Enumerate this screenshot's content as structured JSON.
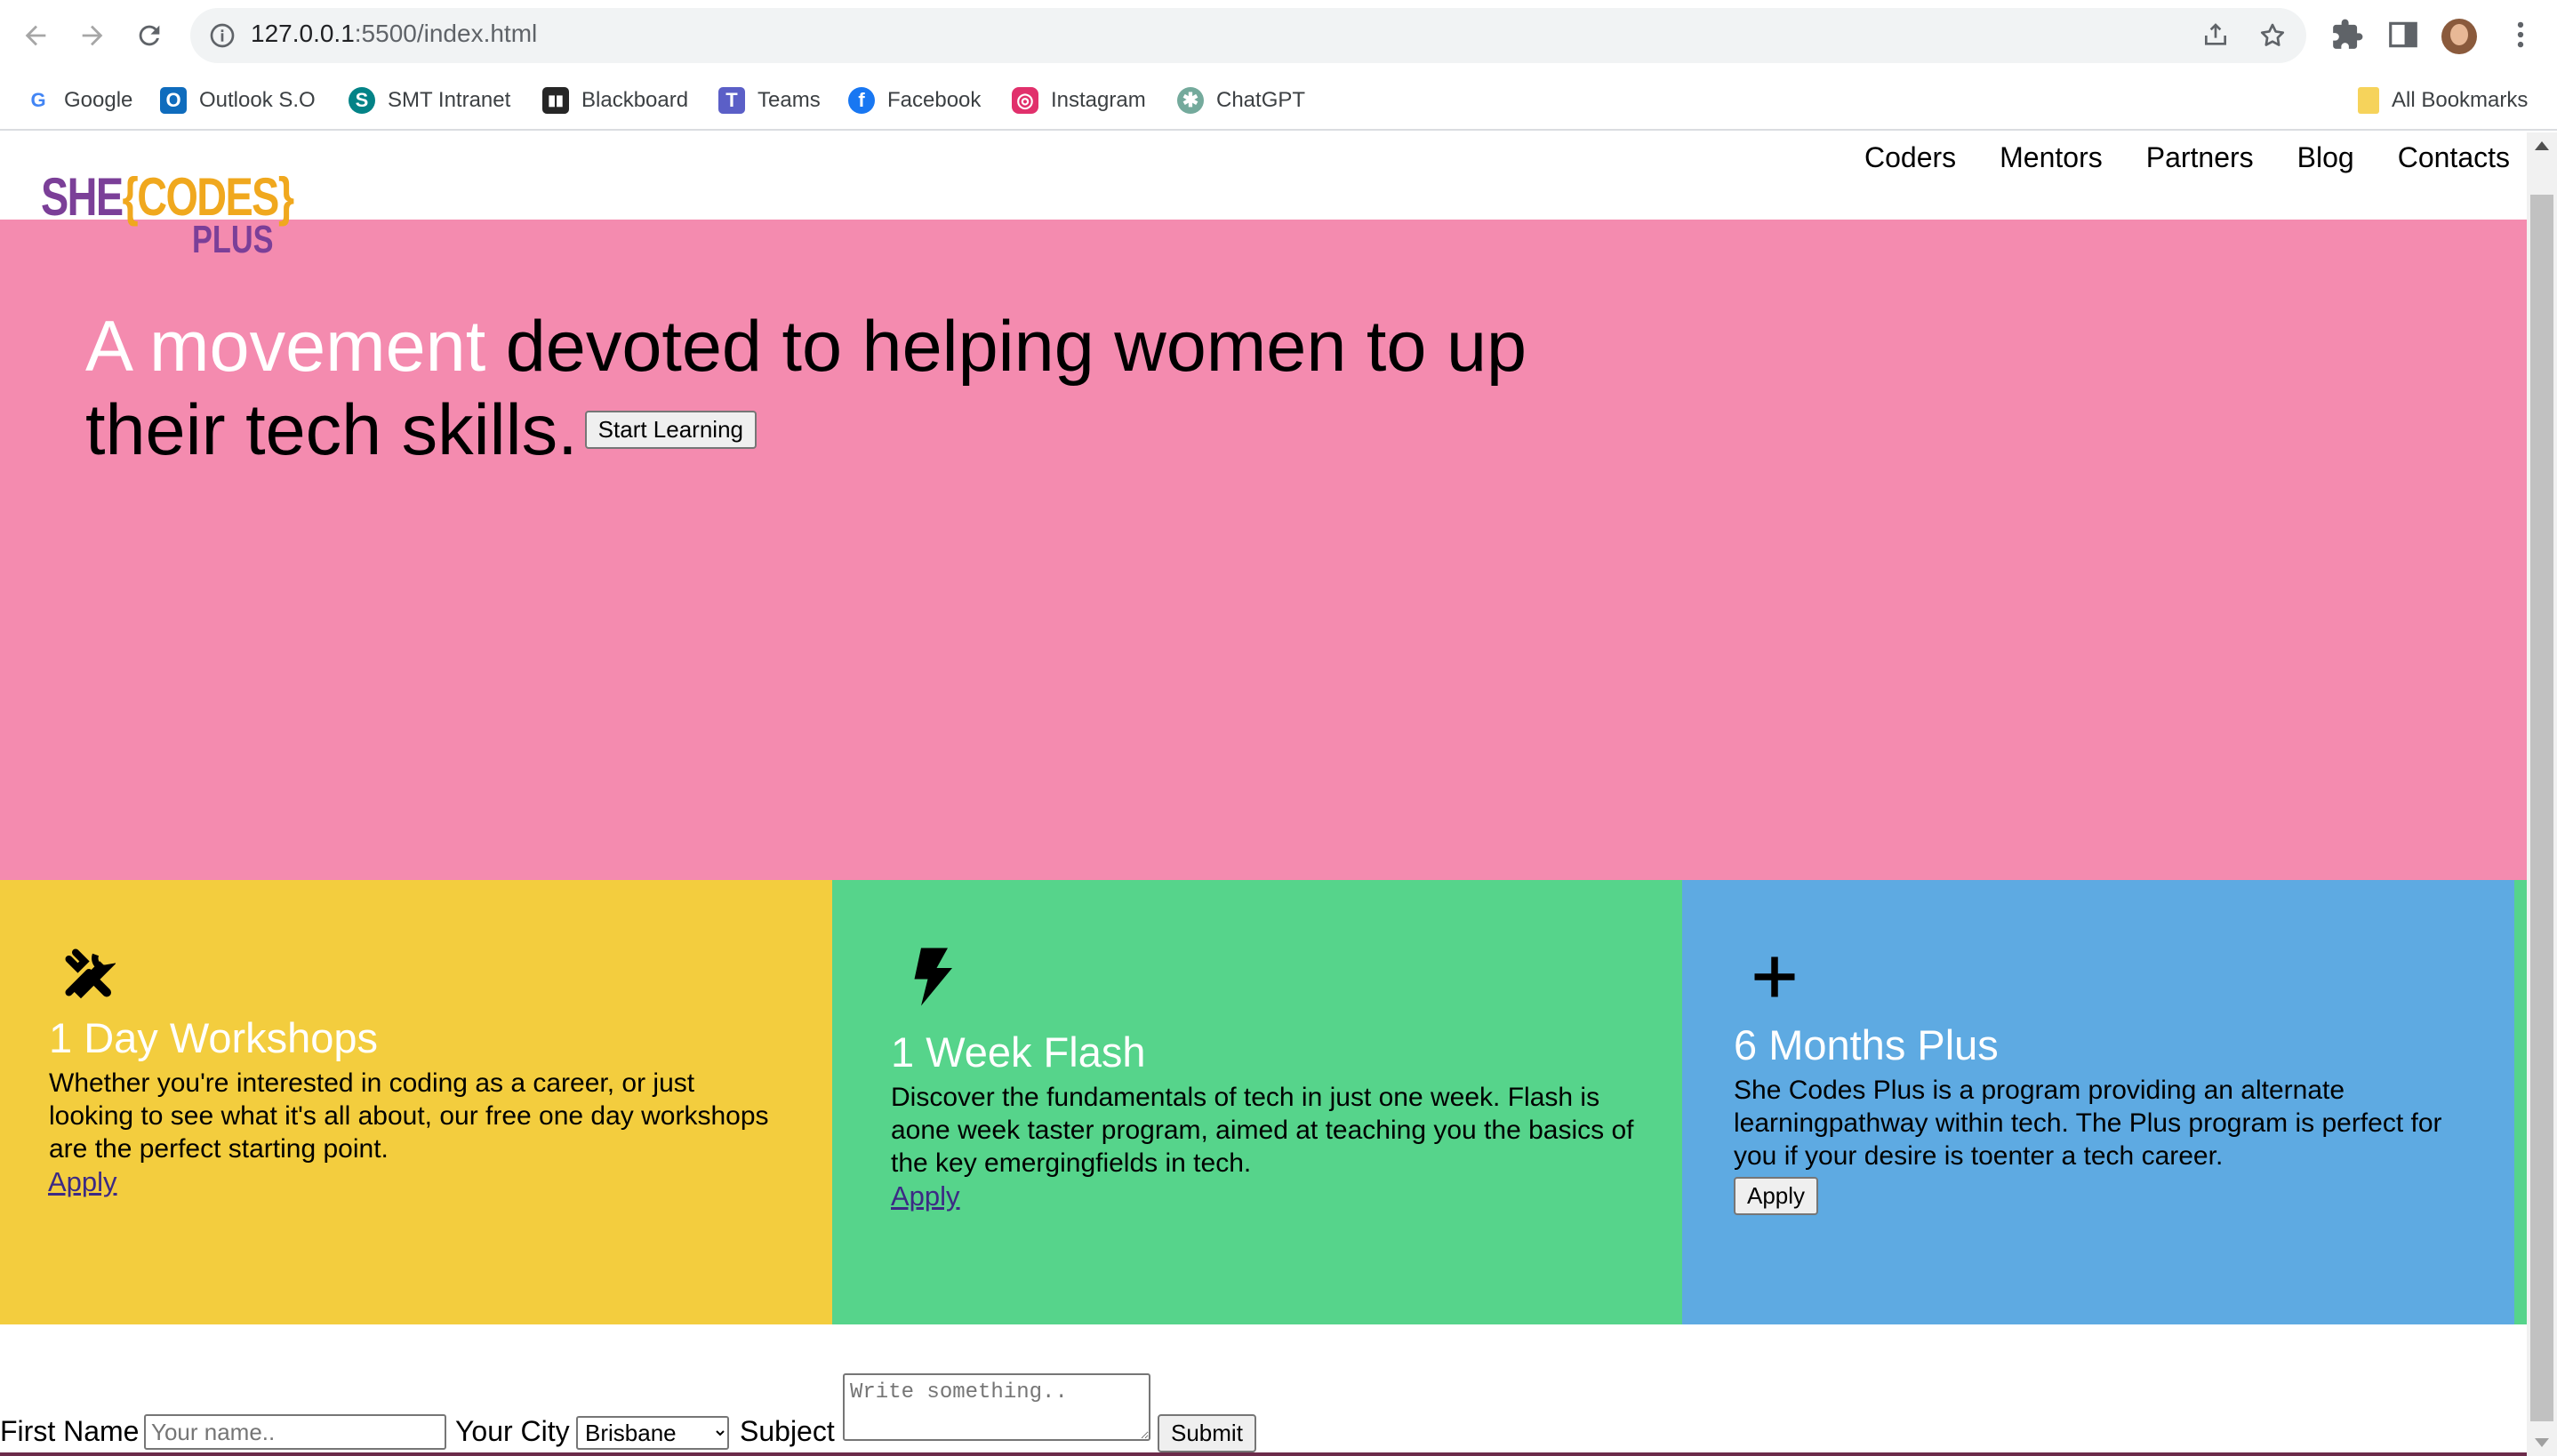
{
  "browser": {
    "url_host": "127.0.0.1",
    "url_path": ":5500/index.html",
    "bookmarks": [
      {
        "label": "Google",
        "icon": "google-icon",
        "color": "#4285f4"
      },
      {
        "label": "Outlook S.O",
        "icon": "outlook-icon",
        "color": "#0f6cbd"
      },
      {
        "label": "SMT Intranet",
        "icon": "sharepoint-icon",
        "color": "#038387"
      },
      {
        "label": "Blackboard",
        "icon": "blackboard-icon",
        "color": "#262626"
      },
      {
        "label": "Teams",
        "icon": "teams-icon",
        "color": "#5b5fc7"
      },
      {
        "label": "Facebook",
        "icon": "facebook-icon",
        "color": "#1877f2"
      },
      {
        "label": "Instagram",
        "icon": "instagram-icon",
        "color": "#e1306c"
      },
      {
        "label": "ChatGPT",
        "icon": "chatgpt-icon",
        "color": "#74aa9c"
      }
    ],
    "all_bookmarks": "All Bookmarks"
  },
  "site": {
    "logo": {
      "she": "SHE",
      "codes": "{CODES}",
      "plus": "PLUS"
    },
    "nav": [
      "Coders",
      "Mentors",
      "Partners",
      "Blog",
      "Contacts"
    ],
    "hero": {
      "highlight": "A movement",
      "rest": " devoted to helping women to up their tech skills.",
      "button": "Start Learning"
    },
    "cards": [
      {
        "title": "1 Day Workshops",
        "icon": "tools-icon",
        "text": "Whether you're interested in coding as a career, or just looking to see what it's all about, our free one day workshops are the perfect starting point.",
        "apply": "Apply",
        "bg": "#f3cd3e"
      },
      {
        "title": "1 Week Flash",
        "icon": "lightning-icon",
        "text": "Discover the fundamentals of tech in just one week. Flash is aone week taster program, aimed at teaching you the basics of the key emergingfields in tech.",
        "apply": "Apply",
        "bg": "#56d48b"
      },
      {
        "title": "6 Months Plus",
        "icon": "plus-icon",
        "text": "She Codes Plus is a program providing an alternate learningpathway within tech. The Plus program is perfect for you if your desire is toenter a tech career.",
        "apply": "Apply",
        "bg": "#5eaae2"
      }
    ],
    "form": {
      "first_name_label": "First Name",
      "first_name_placeholder": "Your name..",
      "city_label": "Your City",
      "city_value": "Brisbane",
      "subject_label": "Subject",
      "subject_placeholder": "Write something..",
      "submit": "Submit"
    }
  }
}
